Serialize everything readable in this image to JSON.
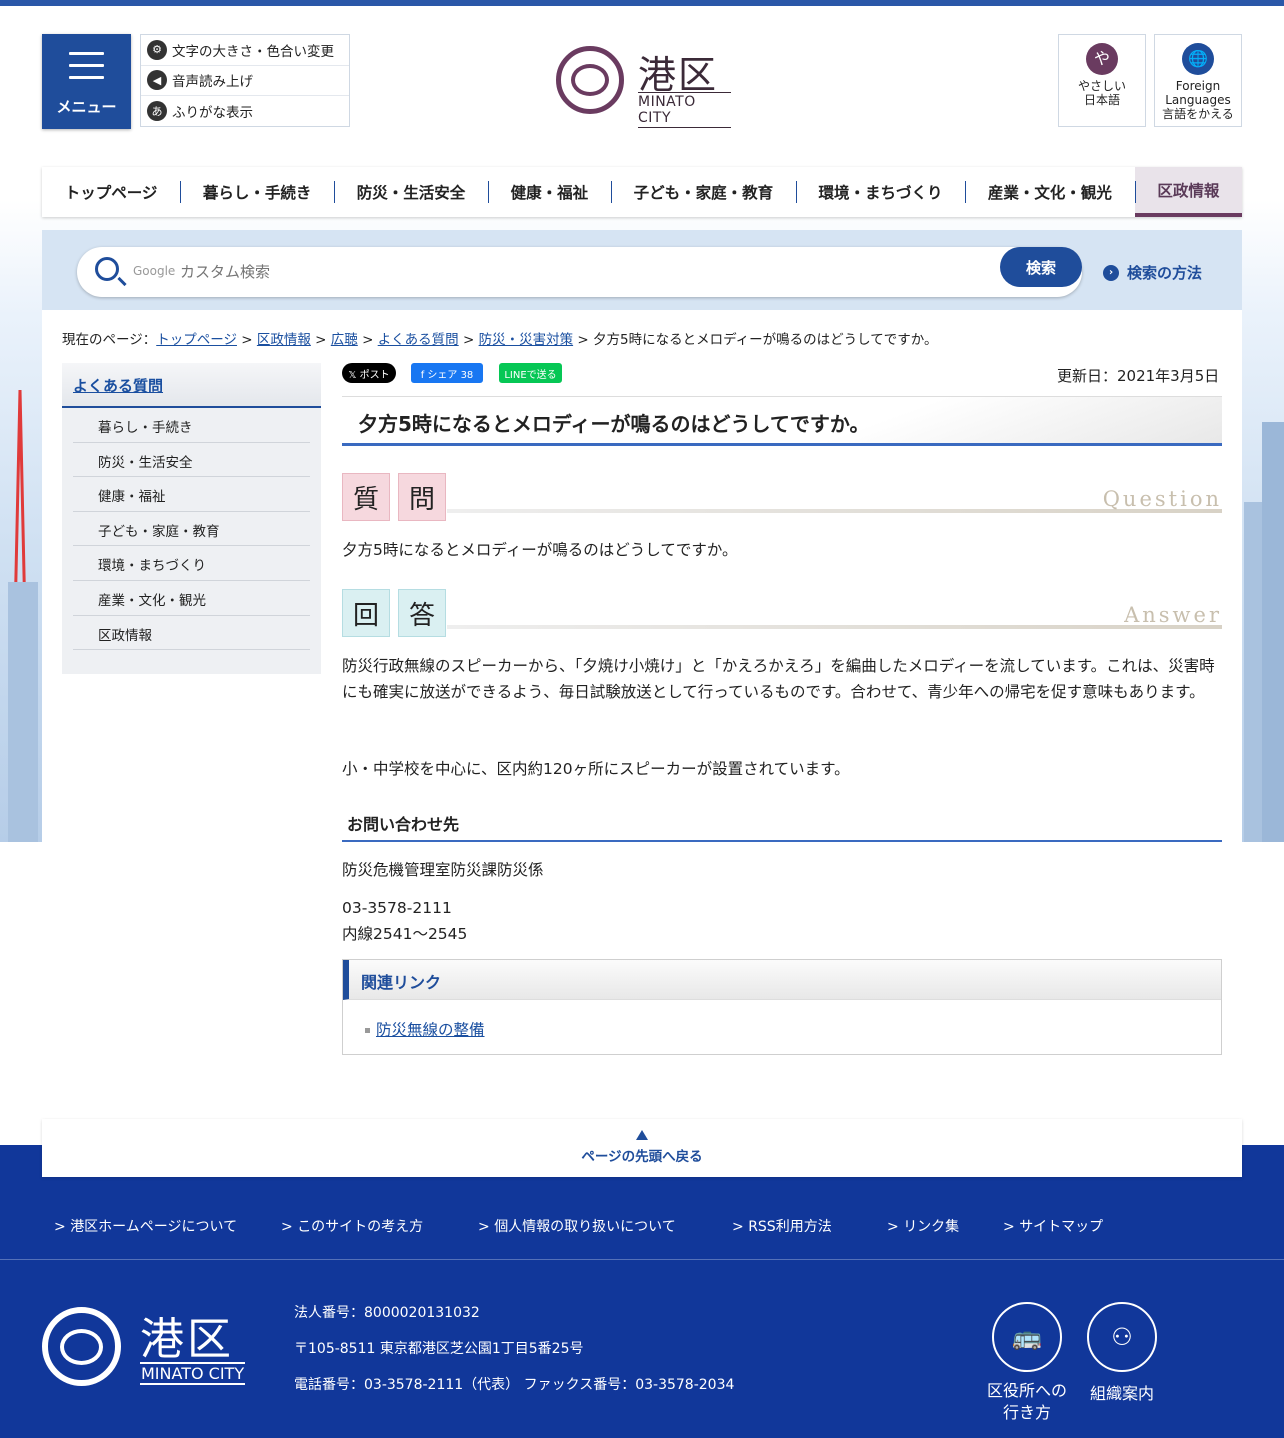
{
  "header": {
    "menu_label": "メニュー",
    "tools": [
      {
        "icon": "gear-icon",
        "glyph": "⚙",
        "label": "文字の大きさ・色合い変更"
      },
      {
        "icon": "speaker-icon",
        "glyph": "◀",
        "label": "音声読み上げ"
      },
      {
        "icon": "furigana-icon",
        "glyph": "あ",
        "label": "ふりがな表示"
      }
    ],
    "logo_name": "港区",
    "logo_en": "MINATO CITY",
    "yasashii": {
      "glyph": "や",
      "line1": "やさしい",
      "line2": "日本語"
    },
    "foreign": {
      "glyph": "🌐",
      "line1": "Foreign",
      "line2": "Languages",
      "line3": "言語をかえる"
    }
  },
  "gnav": [
    "トップページ",
    "暮らし・手続き",
    "防災・生活安全",
    "健康・福祉",
    "子ども・家庭・教育",
    "環境・まちづくり",
    "産業・文化・観光",
    "区政情報"
  ],
  "search": {
    "google": "Google",
    "placeholder": "カスタム検索",
    "button": "検索",
    "help": "検索の方法",
    "help_glyph": "›"
  },
  "breadcrumb": {
    "prefix": "現在のページ：",
    "links": [
      "トップページ",
      "区政情報",
      "広聴",
      "よくある質問",
      "防災・災害対策"
    ],
    "sep": ">",
    "current": "夕方5時になるとメロディーが鳴るのはどうしてですか。"
  },
  "sidebar": {
    "title": "よくある質問",
    "items": [
      "暮らし・手続き",
      "防災・生活安全",
      "健康・福祉",
      "子ども・家庭・教育",
      "環境・まちづくり",
      "産業・文化・観光",
      "区政情報"
    ]
  },
  "share": {
    "x": "𝕏 ポスト",
    "fb": "f シェア 38",
    "line": "LINEで送る"
  },
  "updated": "更新日：2021年3月5日",
  "title": "夕方5時になるとメロディーが鳴るのはどうしてですか。",
  "question": {
    "chars": [
      "質",
      "問"
    ],
    "en": "Question",
    "text": "夕方5時になるとメロディーが鳴るのはどうしてですか。"
  },
  "answer": {
    "chars": [
      "回",
      "答"
    ],
    "en": "Answer",
    "p1": "防災行政無線のスピーカーから、「夕焼け小焼け」と「かえろかえろ」を編曲したメロディーを流しています。これは、災害時にも確実に放送ができるよう、毎日試験放送として行っているものです。合わせて、青少年への帰宅を促す意味もあります。",
    "p2": "小・中学校を中心に、区内約120ヶ所にスピーカーが設置されています。"
  },
  "contact": {
    "heading": "お問い合わせ先",
    "dept": "防災危機管理室防災課防災係",
    "tel": "03-3578-2111",
    "ext": "内線2541～2545"
  },
  "related": {
    "heading": "関連リンク",
    "link": "防災無線の整備"
  },
  "totop": "ページの先頭へ戻る",
  "footer_links": [
    "港区ホームページについて",
    "このサイトの考え方",
    "個人情報の取り扱いについて",
    "RSS利用方法",
    "リンク集",
    "サイトマップ"
  ],
  "footer": {
    "corp_no": "法人番号：8000020131032",
    "address": "〒105-8511 東京都港区芝公園1丁目5番25号",
    "phone": "電話番号：03-3578-2111（代表）  ファックス番号：03-3578-2034",
    "access_line1": "区役所への",
    "access_line2": "行き方",
    "org": "組織案内"
  },
  "colors": {
    "primary": "#1f4d9b",
    "footer": "#11379a",
    "brand_purple": "#6a3b60"
  }
}
